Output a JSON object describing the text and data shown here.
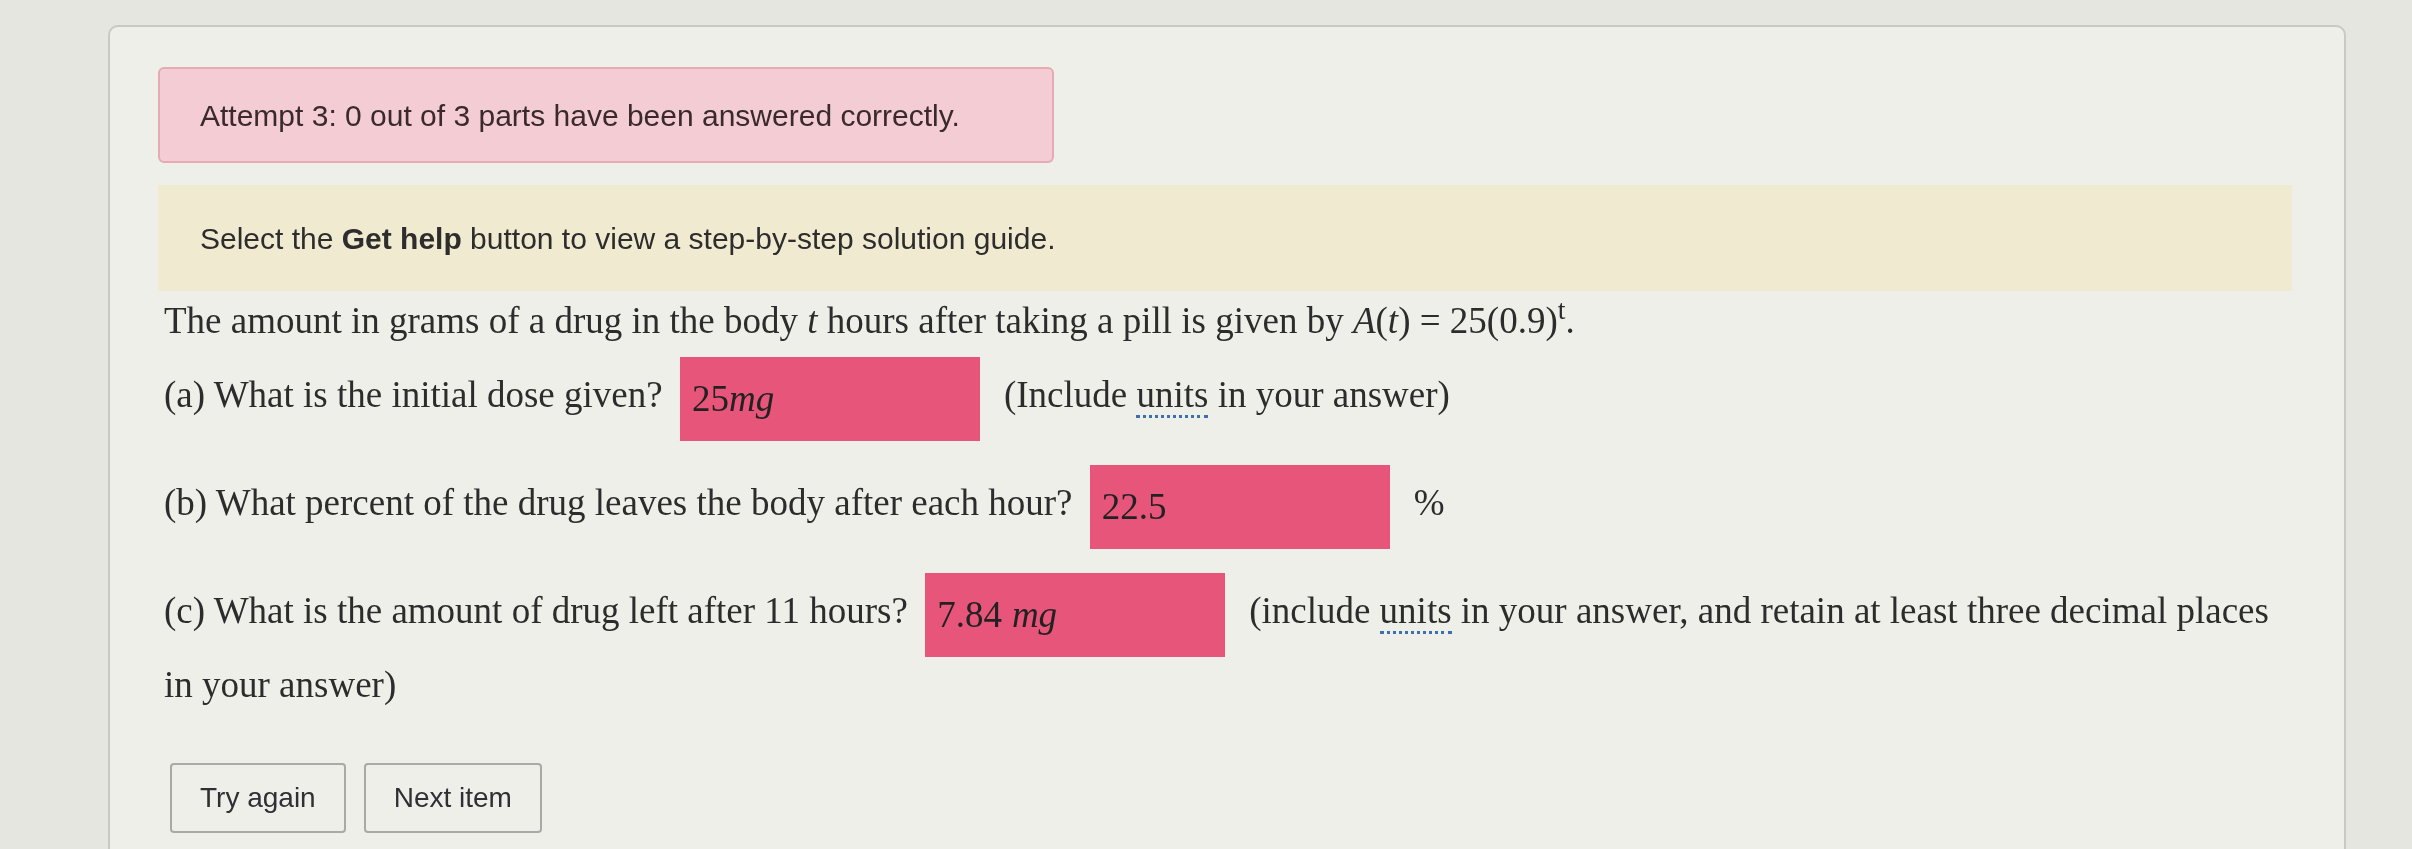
{
  "alert": {
    "text": "Attempt 3: 0 out of 3 parts have been answered correctly."
  },
  "hint": {
    "text": "Select the **Get help** button to view a step-by-step solution guide."
  },
  "problem": {
    "text": "The amount in grams of a drug in the body *t* hours after taking a pill is given by *A*(*t*) = 25(0.9)$^{t}$."
  },
  "parts": [
    {
      "question": "(a) What is the initial dose given?",
      "value": "25",
      "unit": "mg",
      "unit_spaced": false,
      "correct": false,
      "note_before": "(Include ",
      "note_link": "units",
      "note_after": " in your answer)"
    },
    {
      "question": "(b) What percent of the drug leaves the body after each hour?",
      "value": "22.5",
      "correct": false,
      "note_after": "%"
    },
    {
      "question": "(c) What is the amount of drug left after 11 hours?",
      "value": "7.84",
      "unit": "mg",
      "unit_spaced": true,
      "correct": false,
      "note_before": "(include ",
      "note_link": "units",
      "note_after": " in your answer, and retain at least three decimal places in your answer)"
    }
  ],
  "buttons": [
    "Try again",
    "Next item"
  ]
}
